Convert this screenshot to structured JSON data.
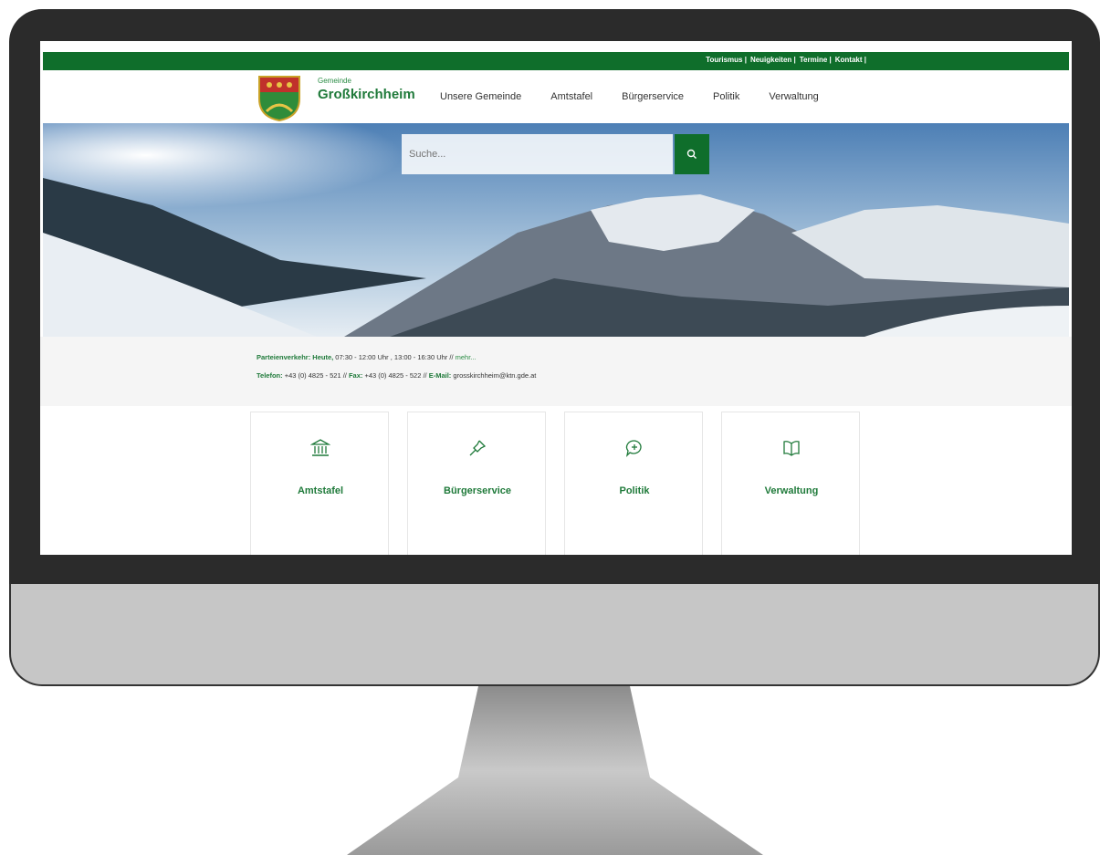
{
  "top_links": [
    "Tourismus |",
    "Neuigkeiten |",
    "Termine |",
    "Kontakt |"
  ],
  "brand": {
    "small": "Gemeinde",
    "name": "Großkirchheim"
  },
  "nav": [
    "Unsere Gemeinde",
    "Amtstafel",
    "Bürgerservice",
    "Politik",
    "Verwaltung"
  ],
  "search": {
    "placeholder": "Suche..."
  },
  "info": {
    "hours_label": "Parteienverkehr: Heute,",
    "hours_text": " 07:30 - 12:00 Uhr , 13:00 - 16:30 Uhr //",
    "more": "mehr...",
    "phone_label": "Telefon:",
    "phone": " +43 (0) 4825 - 521 // ",
    "fax_label": "Fax:",
    "fax": " +43 (0) 4825 - 522 // ",
    "email_label": "E-Mail:",
    "email": " grosskirchheim@ktn.gde.at"
  },
  "tiles": [
    {
      "label": "Amtstafel",
      "icon": "building-columns-icon"
    },
    {
      "label": "Bürgerservice",
      "icon": "pin-icon"
    },
    {
      "label": "Politik",
      "icon": "speech-bubble-plus-icon"
    },
    {
      "label": "Verwaltung",
      "icon": "open-book-icon"
    }
  ],
  "colors": {
    "brand_green": "#0f6e2b",
    "chin": "#c6c6c6",
    "bezel": "#2b2b2b"
  }
}
